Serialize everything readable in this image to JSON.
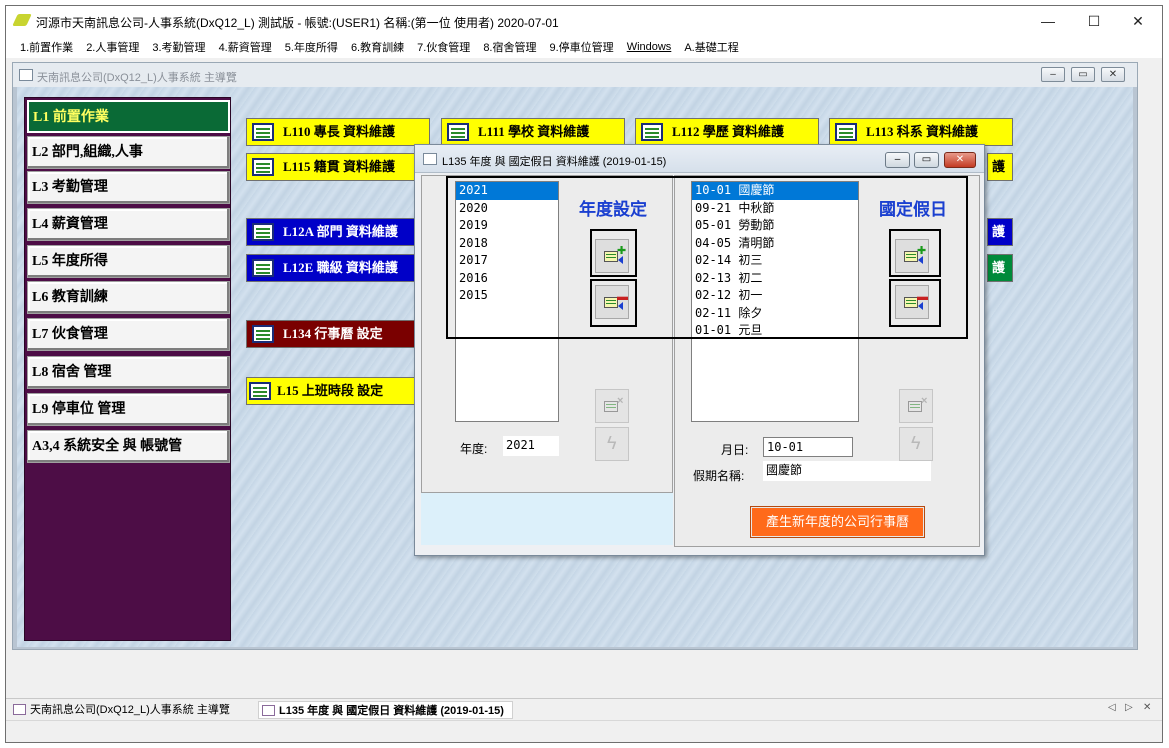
{
  "titlebar": {
    "title": "河源市天南訊息公司-人事系統(DxQ12_L) 測試版 - 帳號:(USER1) 名稱:(第一位 使用者) 2020-07-01",
    "minimize": "—",
    "maximize": "☐",
    "close": "✕"
  },
  "menu": [
    "1.前置作業",
    "2.人事管理",
    "3.考勤管理",
    "4.薪資管理",
    "5.年度所得",
    "6.教育訓練",
    "7.伙食管理",
    "8.宿舍管理",
    "9.停車位管理",
    "Windows",
    "A.基礎工程"
  ],
  "main_window": {
    "title": "天南訊息公司(DxQ12_L)人事系統 主導覽",
    "btn_min": "–",
    "btn_max": "▭",
    "btn_close": "✕"
  },
  "left_nav": [
    "L1  前置作業",
    "L2 部門,組織,人事",
    "L3 考勤管理",
    "L4 薪資管理",
    "L5 年度所得",
    "L6 教育訓練",
    "L7 伙食管理",
    "L8 宿舍 管理",
    "L9 停車位 管理",
    "A3,4 系統安全 與 帳號管"
  ],
  "tiles": {
    "l110": "L110 專長 資料維護",
    "l111": "L111 學校 資料維護",
    "l112": "L112 學歷 資料維護",
    "l113": "L113 科系 資料維護",
    "l115": "L115 籍貫 資料維護",
    "l116_edge": "護",
    "l12a": "L12A 部門 資料維護",
    "l12a_right_edge": "護",
    "l12e": "L12E 職級 資料維護",
    "l12e_right_edge": "護",
    "l134": "L134 行事曆 設定",
    "l15": "L15 上班時段 設定"
  },
  "dialog": {
    "title": "L135 年度 與 國定假日 資料維護 (2019-01-15)",
    "btn_min": "–",
    "btn_max": "▭",
    "btn_close": "✕",
    "year_heading": "年度設定",
    "holiday_heading": "國定假日",
    "years": [
      "2021",
      "2020",
      "2019",
      "2018",
      "2017",
      "2016",
      "2015"
    ],
    "holidays": [
      "10-01 國慶節",
      "09-21 中秋節",
      "05-01  勞動節",
      "04-05 清明節",
      "02-14 初三",
      "02-13 初二",
      "02-12 初一",
      "02-11 除夕",
      "01-01 元旦"
    ],
    "year_label": "年度:",
    "year_value": "2021",
    "monthday_label": "月日:",
    "monthday_value": "10-01",
    "holiday_name_label": "假期名稱:",
    "holiday_name_value": "國慶節",
    "generate_button": "產生新年度的公司行事曆"
  },
  "taskbar": {
    "task1": "天南訊息公司(DxQ12_L)人事系統 主導覽",
    "task2": "L135 年度 與 國定假日 資料維護 (2019-01-15)",
    "prev": "◁",
    "next": "▷",
    "close": "✕"
  }
}
